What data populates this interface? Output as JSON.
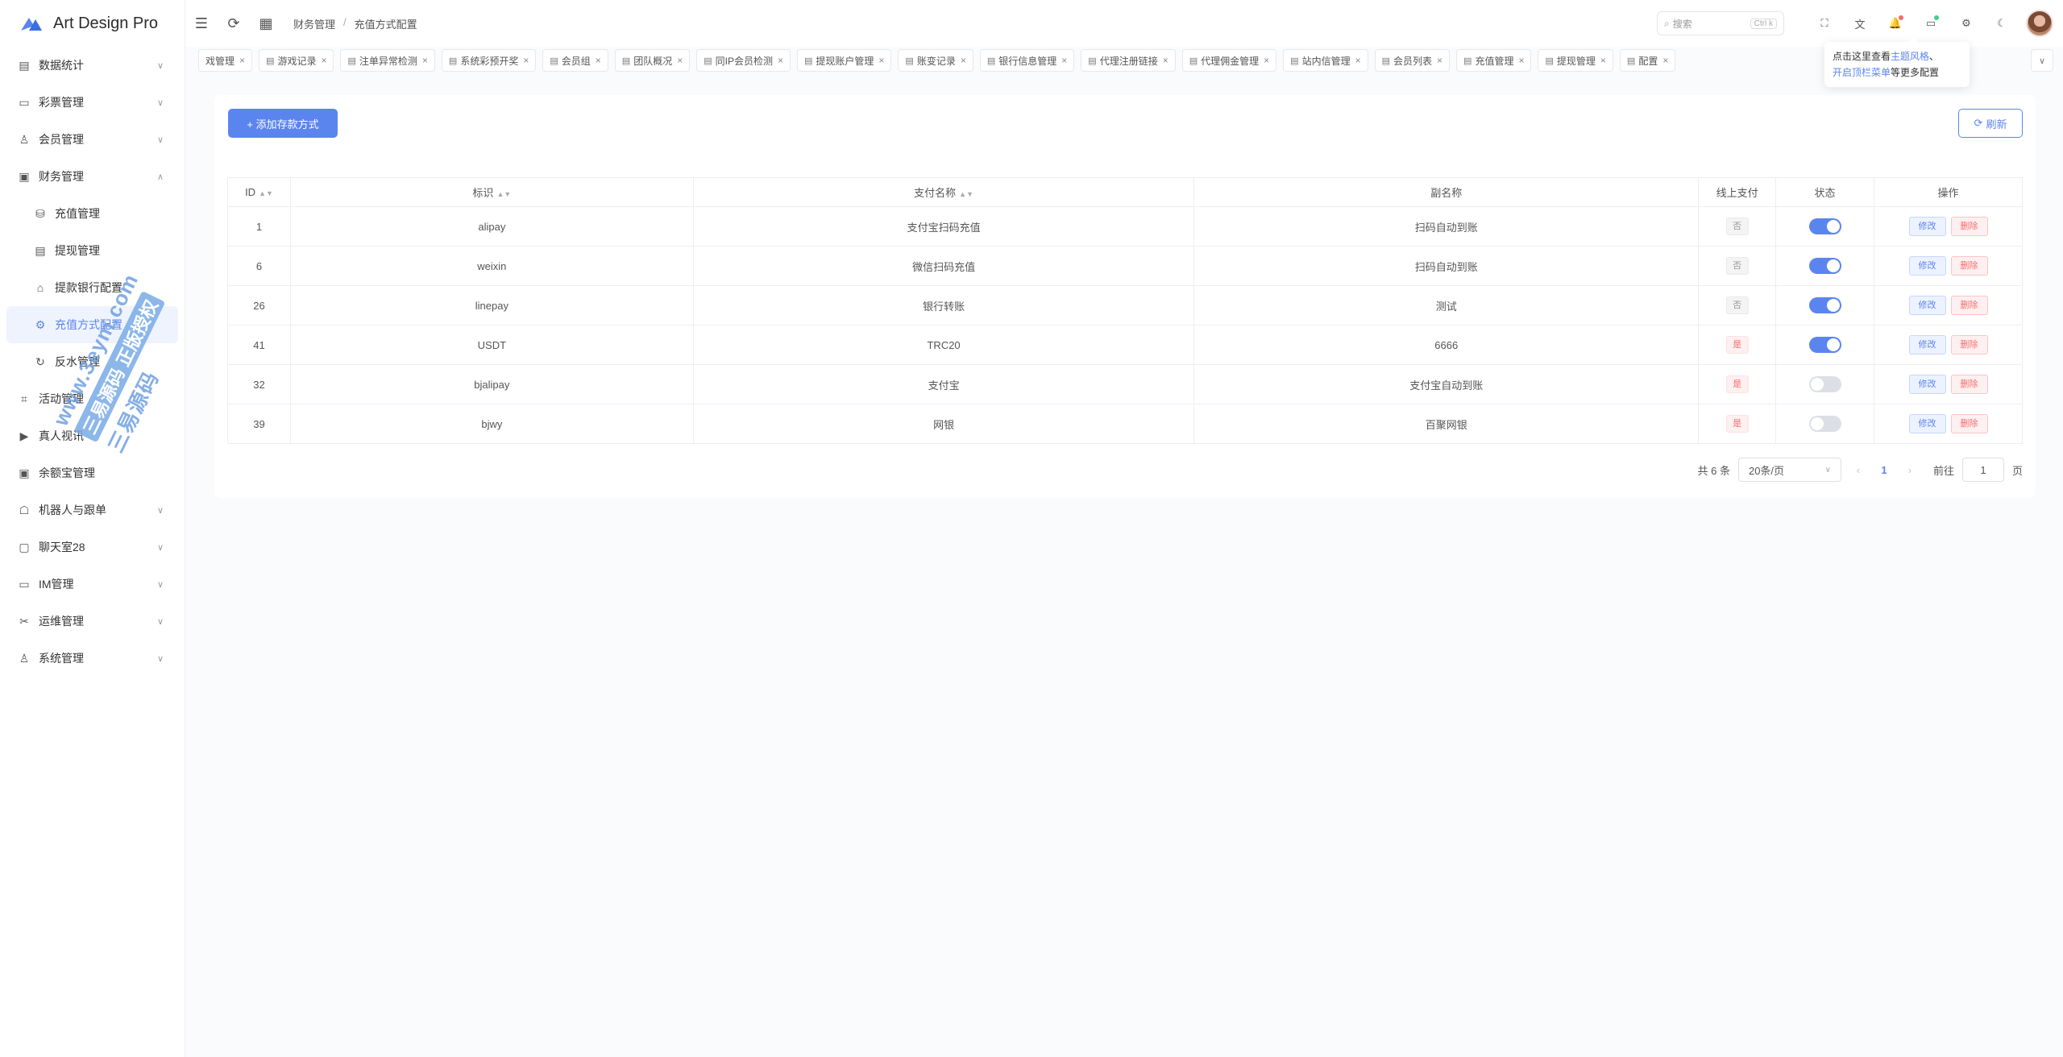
{
  "app": {
    "title": "Art Design Pro"
  },
  "sidebar": {
    "items": [
      {
        "label": "数据统计",
        "icon": "chart-icon",
        "chevron": "∨"
      },
      {
        "label": "彩票管理",
        "icon": "ticket-icon",
        "chevron": "∨"
      },
      {
        "label": "会员管理",
        "icon": "user-icon",
        "chevron": "∨"
      },
      {
        "label": "财务管理",
        "icon": "wallet-icon",
        "chevron": "∧"
      },
      {
        "label": "充值管理",
        "icon": "coins-icon",
        "chevron": ""
      },
      {
        "label": "提现管理",
        "icon": "card-icon",
        "chevron": ""
      },
      {
        "label": "提款银行配置",
        "icon": "bank-icon",
        "chevron": ""
      },
      {
        "label": "充值方式配置",
        "icon": "settings-icon",
        "chevron": ""
      },
      {
        "label": "反水管理",
        "icon": "rebate-icon",
        "chevron": ""
      },
      {
        "label": "活动管理",
        "icon": "gift-icon",
        "chevron": ""
      },
      {
        "label": "真人视讯",
        "icon": "video-icon",
        "chevron": ""
      },
      {
        "label": "余额宝管理",
        "icon": "safe-icon",
        "chevron": ""
      },
      {
        "label": "机器人与跟单",
        "icon": "robot-icon",
        "chevron": "∨"
      },
      {
        "label": "聊天室28",
        "icon": "chat-icon",
        "chevron": "∨"
      },
      {
        "label": "IM管理",
        "icon": "message-icon",
        "chevron": "∨"
      },
      {
        "label": "运维管理",
        "icon": "tools-icon",
        "chevron": "∨"
      },
      {
        "label": "系统管理",
        "icon": "user-icon",
        "chevron": "∨"
      }
    ]
  },
  "header": {
    "breadcrumb": [
      "财务管理",
      "充值方式配置"
    ],
    "breadcrumb_sep": "/",
    "search_placeholder": "搜索",
    "search_kbd": "Ctrl k"
  },
  "tabs": [
    {
      "label": "戏管理"
    },
    {
      "label": "游戏记录"
    },
    {
      "label": "注单异常检测"
    },
    {
      "label": "系统彩预开奖"
    },
    {
      "label": "会员组"
    },
    {
      "label": "团队概况"
    },
    {
      "label": "同IP会员检测"
    },
    {
      "label": "提现账户管理"
    },
    {
      "label": "账变记录"
    },
    {
      "label": "银行信息管理"
    },
    {
      "label": "代理注册链接"
    },
    {
      "label": "代理佣金管理"
    },
    {
      "label": "站内信管理"
    },
    {
      "label": "会员列表"
    },
    {
      "label": "充值管理"
    },
    {
      "label": "提现管理"
    },
    {
      "label": "配置"
    }
  ],
  "tooltip": {
    "line1_prefix": "点击这里查看",
    "line1_link": "主题风格",
    "line1_suffix": "、",
    "line2_link": "开启顶栏菜单",
    "line2_suffix": "等更多配置"
  },
  "toolbar": {
    "add_label": "+ 添加存款方式",
    "refresh_label": "刷新"
  },
  "table": {
    "columns": [
      "ID",
      "标识",
      "支付名称",
      "副名称",
      "线上支付",
      "状态",
      "操作"
    ],
    "rows": [
      {
        "id": "1",
        "code": "alipay",
        "name": "支付宝扫码充值",
        "subname": "扫码自动到账",
        "online": "否",
        "online_flag": false,
        "enabled": true
      },
      {
        "id": "6",
        "code": "weixin",
        "name": "微信扫码充值",
        "subname": "扫码自动到账",
        "online": "否",
        "online_flag": false,
        "enabled": true
      },
      {
        "id": "26",
        "code": "linepay",
        "name": "银行转账",
        "subname": "测试",
        "online": "否",
        "online_flag": false,
        "enabled": true
      },
      {
        "id": "41",
        "code": "USDT",
        "name": "TRC20",
        "subname": "6666",
        "online": "是",
        "online_flag": true,
        "enabled": true
      },
      {
        "id": "32",
        "code": "bjalipay",
        "name": "支付宝",
        "subname": "支付宝自动到账",
        "online": "是",
        "online_flag": true,
        "enabled": false
      },
      {
        "id": "39",
        "code": "bjwy",
        "name": "网银",
        "subname": "百聚网银",
        "online": "是",
        "online_flag": true,
        "enabled": false
      }
    ],
    "edit_label": "修改",
    "delete_label": "删除"
  },
  "pagination": {
    "total_text": "共 6 条",
    "page_size": "20条/页",
    "current_page": "1",
    "goto_label": "前往",
    "goto_value": "1",
    "page_suffix": "页"
  },
  "watermark": {
    "line1": "www.3eym.com",
    "line2": "三易源码 正版授权",
    "line3": "三易源码"
  },
  "colors": {
    "accent": "#5b85ee",
    "danger": "#f56c6c"
  }
}
